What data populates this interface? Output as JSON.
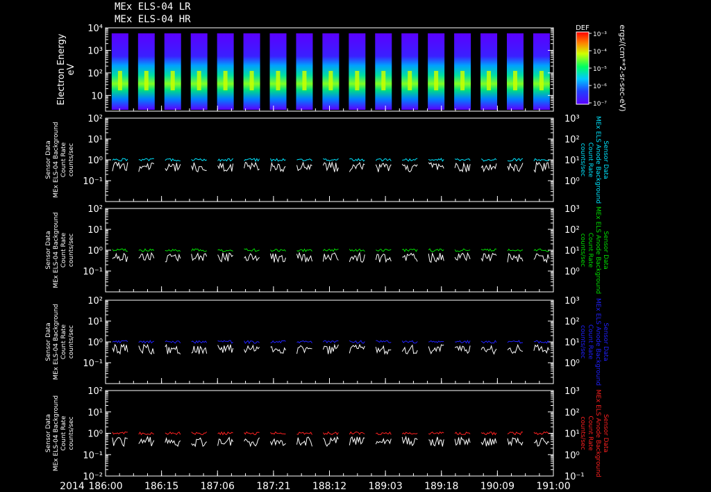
{
  "titles": [
    "MEx ELS-04 LR",
    "MEx ELS-04 HR"
  ],
  "colors": {
    "background": "#000000",
    "axes": "#ffffff",
    "right_label_colors": [
      "#00e5ff",
      "#00e000",
      "#2020ff",
      "#ff2020"
    ]
  },
  "chart_data": [
    {
      "type": "heatmap",
      "ylabel": [
        "Electron Energy",
        "eV"
      ],
      "yscale": "log",
      "ylim": [
        2,
        10000
      ],
      "yticks": [
        {
          "value": 10,
          "label": "10"
        },
        {
          "value": 100,
          "label": "10²"
        },
        {
          "value": 1000,
          "label": "10³"
        },
        {
          "value": 10000,
          "label": "10⁴"
        }
      ],
      "colorbar": {
        "title": "DEF",
        "label": "ergs/(cm**2-sr-sec-eV)",
        "ticks": [
          "10⁻³",
          "10⁻⁴",
          "10⁻⁵",
          "10⁻⁶",
          "10⁻⁷"
        ]
      },
      "burst_count": 17
    },
    {
      "type": "line",
      "left_ylabel": [
        "Sensor Data",
        "MEx ELS-04 Background",
        "Count Rate",
        "counts/sec"
      ],
      "right_ylabel": [
        "Sensor Data",
        "MEx ELS Anode Background",
        "Count Rate",
        "counts/sec"
      ],
      "left_yticks": [
        "10²",
        "10¹",
        "10⁰",
        "10⁻¹"
      ],
      "right_yticks": [
        "10³",
        "10²",
        "10¹",
        "10⁰"
      ],
      "series": [
        {
          "color": "#00e5ff",
          "level": 0.8
        },
        {
          "color": "#ffffff",
          "level": 0.55
        }
      ]
    },
    {
      "type": "line",
      "left_ylabel": [
        "Sensor Data",
        "MEx ELS-04 Background",
        "Count Rate",
        "counts/sec"
      ],
      "right_ylabel": [
        "Sensor Data",
        "MEx ELS Anode Background",
        "Count Rate",
        "counts/sec"
      ],
      "left_yticks": [
        "10²",
        "10¹",
        "10⁰",
        "10⁻¹"
      ],
      "right_yticks": [
        "10³",
        "10²",
        "10¹",
        "10⁰"
      ],
      "series": [
        {
          "color": "#00e000",
          "level": 0.85
        },
        {
          "color": "#ffffff",
          "level": 0.55
        }
      ]
    },
    {
      "type": "line",
      "left_ylabel": [
        "Sensor Data",
        "MEx ELS-04 Background",
        "Count Rate",
        "counts/sec"
      ],
      "right_ylabel": [
        "Sensor Data",
        "MEx ELS Anode Background",
        "Count Rate",
        "counts/sec"
      ],
      "left_yticks": [
        "10²",
        "10¹",
        "10⁰",
        "10⁻¹"
      ],
      "right_yticks": [
        "10³",
        "10²",
        "10¹",
        "10⁰"
      ],
      "series": [
        {
          "color": "#2020ff",
          "level": 0.8
        },
        {
          "color": "#ffffff",
          "level": 0.55
        }
      ]
    },
    {
      "type": "line",
      "left_ylabel": [
        "Sensor Data",
        "MEx ELS-04 Background",
        "Count Rate",
        "counts/sec"
      ],
      "right_ylabel": [
        "Sensor Data",
        "MEx ELS Anode Background",
        "Count Rate",
        "counts/sec"
      ],
      "left_yticks": [
        "10²",
        "10¹",
        "10⁰",
        "10⁻¹",
        "10⁻²"
      ],
      "right_yticks": [
        "10³",
        "10²",
        "10¹",
        "10⁰",
        "10⁻¹"
      ],
      "series": [
        {
          "color": "#ff2020",
          "level": 0.85
        },
        {
          "color": "#ffffff",
          "level": 0.5
        }
      ]
    }
  ],
  "xaxis": {
    "year": "2014",
    "ticks": [
      "186:00",
      "186:15",
      "187:06",
      "187:21",
      "188:12",
      "189:03",
      "189:18",
      "190:09",
      "191:00"
    ]
  }
}
